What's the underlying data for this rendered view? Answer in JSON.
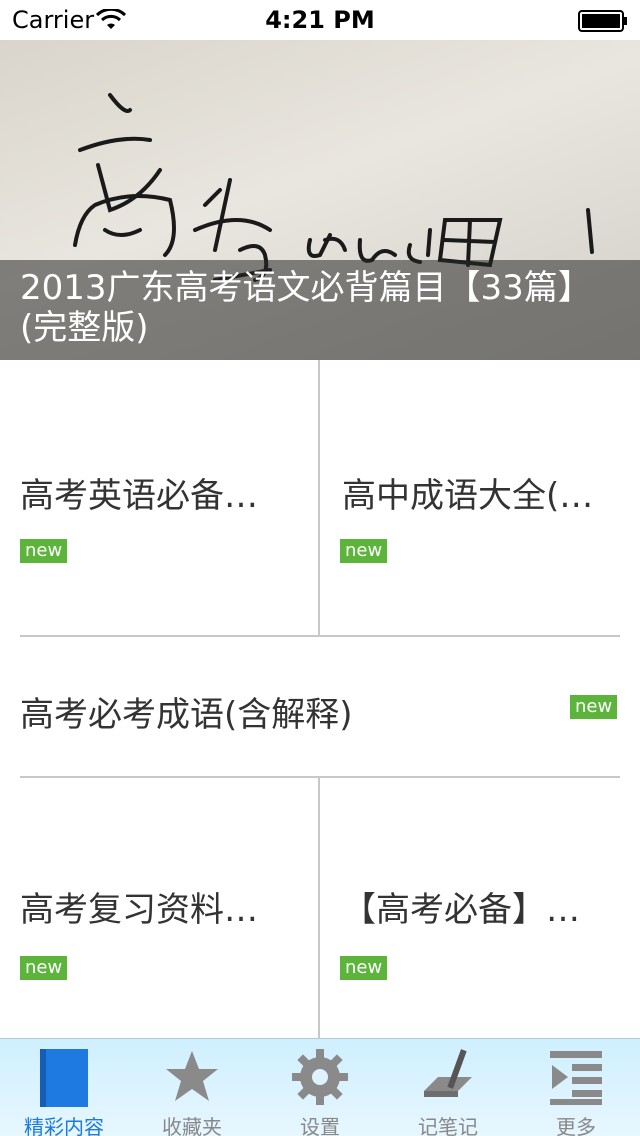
{
  "status_bar": {
    "carrier": "Carrier",
    "time": "4:21 PM"
  },
  "banner": {
    "title": "2013广东高考语文必背篇目【33篇】(完整版)",
    "image": "handwritten-calligraphy-photo"
  },
  "grid": {
    "row1": [
      {
        "title": "高考英语必备…",
        "badge": "new"
      },
      {
        "title": "高中成语大全(…",
        "badge": "new"
      }
    ],
    "row2": {
      "title": "高考必考成语(含解释)",
      "badge": "new"
    },
    "row3": [
      {
        "title": "高考复习资料…",
        "badge": "new"
      },
      {
        "title": "【高考必备】…",
        "badge": "new"
      }
    ]
  },
  "tabbar": {
    "tabs": [
      {
        "label": "精彩内容",
        "icon": "book-icon",
        "active": true
      },
      {
        "label": "收藏夹",
        "icon": "star-icon",
        "active": false
      },
      {
        "label": "设置",
        "icon": "gear-icon",
        "active": false
      },
      {
        "label": "记笔记",
        "icon": "pen-icon",
        "active": false
      },
      {
        "label": "更多",
        "icon": "list-icon",
        "active": false
      }
    ]
  },
  "colors": {
    "badge": "#5cb43b",
    "active_tab": "#1e7ae0",
    "divider": "#c8c8c8"
  }
}
